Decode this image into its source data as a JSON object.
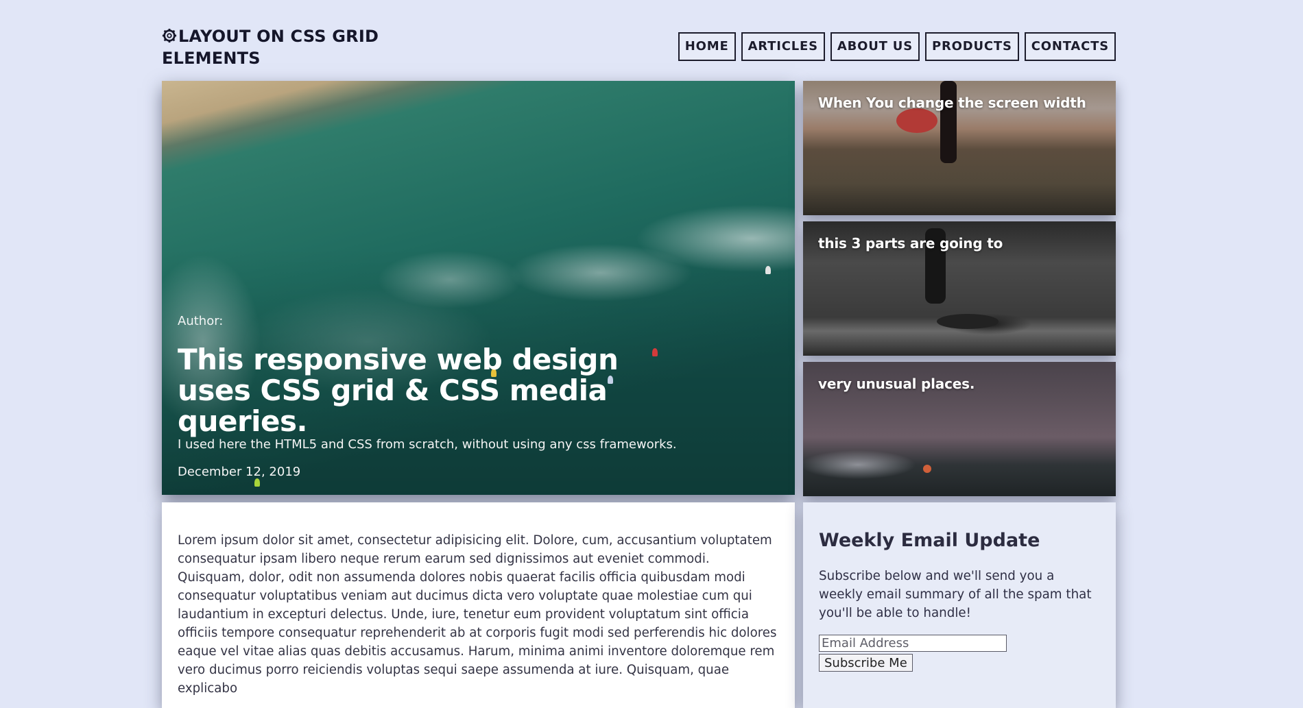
{
  "header": {
    "logo_text": "LAYOUT ON CSS GRID ELEMENTS",
    "nav": [
      "HOME",
      "ARTICLES",
      "ABOUT US",
      "PRODUCTS",
      "CONTACTS"
    ]
  },
  "hero": {
    "author": "Author:",
    "title": "This responsive web design uses CSS grid & CSS media queries.",
    "description": "I used here the HTML5 and CSS from scratch, without using any css frameworks.",
    "date": "December 12, 2019"
  },
  "side_cards": [
    {
      "caption": "When You change the screen width"
    },
    {
      "caption": "this 3 parts are going to"
    },
    {
      "caption": "very unusual places."
    }
  ],
  "article": {
    "body": "Lorem ipsum dolor sit amet, consectetur adipisicing elit. Dolore, cum, accusantium voluptatem consequatur ipsam libero neque rerum earum sed dignissimos aut eveniet commodi. Quisquam, dolor, odit non assumenda dolores nobis quaerat facilis officia quibusdam modi consequatur voluptatibus veniam aut ducimus dicta vero voluptate quae molestiae cum qui laudantium in excepturi delectus. Unde, iure, tenetur eum provident voluptatum sint officia officiis tempore consequatur reprehenderit ab at corporis fugit modi sed perferendis hic dolores eaque vel vitae alias quas debitis accusamus. Harum, minima animi inventore doloremque rem vero ducimus porro reiciendis voluptas sequi saepe assumenda at iure. Quisquam, quae explicabo"
  },
  "newsletter": {
    "title": "Weekly Email Update",
    "text": "Subscribe below and we'll send you a weekly email summary of all the spam that you'll be able to handle!",
    "email_placeholder": "Email Address",
    "button_label": "Subscribe Me"
  },
  "icons": {
    "logo_icon": "gear-icon"
  }
}
